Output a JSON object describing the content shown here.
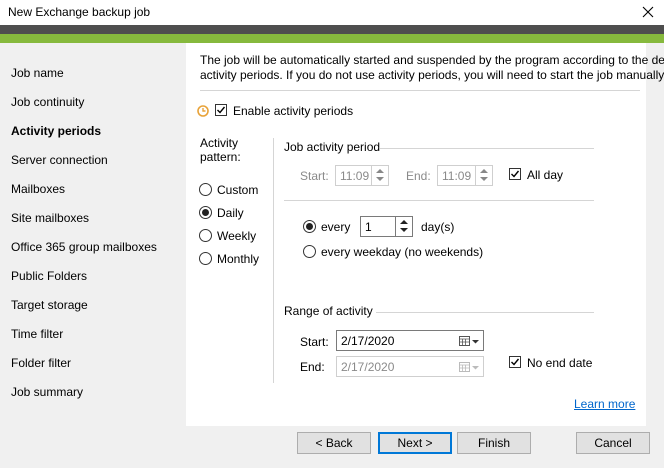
{
  "window": {
    "title": "New Exchange backup job"
  },
  "sidebar": {
    "items": [
      {
        "label": "Job name"
      },
      {
        "label": "Job continuity"
      },
      {
        "label": "Activity periods",
        "active": true
      },
      {
        "label": "Server connection"
      },
      {
        "label": "Mailboxes"
      },
      {
        "label": "Site mailboxes"
      },
      {
        "label": "Office 365 group mailboxes"
      },
      {
        "label": "Public Folders"
      },
      {
        "label": "Target storage"
      },
      {
        "label": "Time filter"
      },
      {
        "label": "Folder filter"
      },
      {
        "label": "Job summary"
      }
    ]
  },
  "content": {
    "description_line1": "The job will be automatically started and suspended by the program according to the defined",
    "description_line2": "activity periods. If you do not use activity periods, you will need to start the job manually.",
    "enable_label": "Enable activity periods",
    "enable_checked": true,
    "pattern_label_line1": "Activity",
    "pattern_label_line2": "pattern:",
    "patterns": [
      {
        "label": "Custom",
        "selected": false
      },
      {
        "label": "Daily",
        "selected": true
      },
      {
        "label": "Weekly",
        "selected": false
      },
      {
        "label": "Monthly",
        "selected": false
      }
    ],
    "job_period": {
      "heading": "Job activity period",
      "start_label": "Start:",
      "start_value": "11:09",
      "end_label": "End:",
      "end_value": "11:09",
      "all_day_label": "All day",
      "all_day_checked": true
    },
    "recurrence": {
      "every_label": "every",
      "every_value": "1",
      "days_label": "day(s)",
      "weekday_label": "every weekday (no weekends)",
      "every_selected": true
    },
    "range": {
      "heading": "Range of activity",
      "start_label": "Start:",
      "start_value": "2/17/2020",
      "end_label": "End:",
      "end_value": "2/17/2020",
      "no_end_label": "No end date",
      "no_end_checked": true
    },
    "learn_more": "Learn more"
  },
  "footer": {
    "back": "< Back",
    "next": "Next >",
    "finish": "Finish",
    "cancel": "Cancel"
  },
  "colors": {
    "accent_green": "#86b93d",
    "band_gray": "#4e4e4e",
    "link": "#0066cc",
    "clock_icon": "#e8a33a"
  }
}
